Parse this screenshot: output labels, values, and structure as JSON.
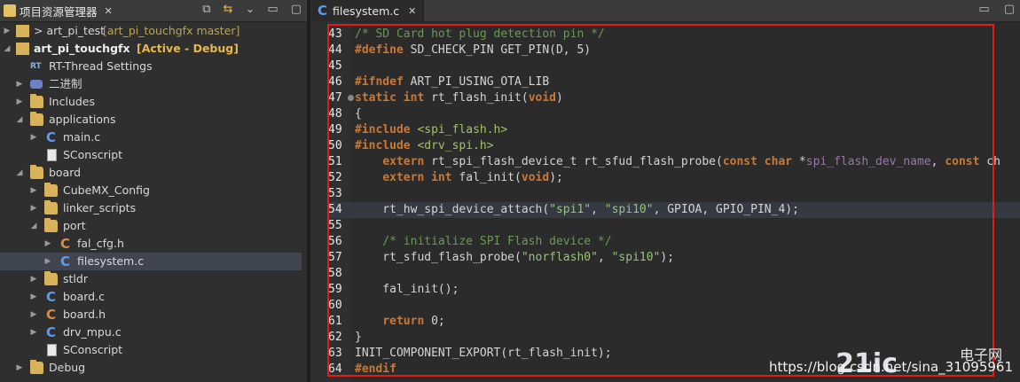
{
  "explorer": {
    "title": "项目资源管理器",
    "items": [
      {
        "label": "> art_pi_test",
        "suffix": "[art_pi_touchgfx master]"
      },
      {
        "label": "art_pi_touchgfx",
        "suffix": "[Active - Debug]"
      },
      {
        "label": "RT-Thread Settings"
      },
      {
        "label": "二进制"
      },
      {
        "label": "Includes"
      },
      {
        "label": "applications"
      },
      {
        "label": "main.c"
      },
      {
        "label": "SConscript"
      },
      {
        "label": "board"
      },
      {
        "label": "CubeMX_Config"
      },
      {
        "label": "linker_scripts"
      },
      {
        "label": "port"
      },
      {
        "label": "fal_cfg.h"
      },
      {
        "label": "filesystem.c"
      },
      {
        "label": "stldr"
      },
      {
        "label": "board.c"
      },
      {
        "label": "board.h"
      },
      {
        "label": "drv_mpu.c"
      },
      {
        "label": "SConscript"
      },
      {
        "label": "Debug"
      }
    ]
  },
  "editor": {
    "tab_title": "filesystem.c",
    "lines": [
      {
        "num": "43",
        "text": "/* SD Card hot plug detection pin */"
      },
      {
        "num": "44",
        "text": "#define SD_CHECK_PIN GET_PIN(D, 5)"
      },
      {
        "num": "45",
        "text": ""
      },
      {
        "num": "46",
        "text": "#ifndef ART_PI_USING_OTA_LIB"
      },
      {
        "num": "47",
        "text": "static int rt_flash_init(void)"
      },
      {
        "num": "48",
        "text": "{"
      },
      {
        "num": "49",
        "text": "#include <spi_flash.h>"
      },
      {
        "num": "50",
        "text": "#include <drv_spi.h>"
      },
      {
        "num": "51",
        "text": "    extern rt_spi_flash_device_t rt_sfud_flash_probe(const char *spi_flash_dev_name, const ch"
      },
      {
        "num": "52",
        "text": "    extern int fal_init(void);"
      },
      {
        "num": "53",
        "text": ""
      },
      {
        "num": "54",
        "text": "    rt_hw_spi_device_attach(\"spi1\", \"spi10\", GPIOA, GPIO_PIN_4);"
      },
      {
        "num": "55",
        "text": ""
      },
      {
        "num": "56",
        "text": "    /* initialize SPI Flash device */"
      },
      {
        "num": "57",
        "text": "    rt_sfud_flash_probe(\"norflash0\", \"spi10\");"
      },
      {
        "num": "58",
        "text": ""
      },
      {
        "num": "59",
        "text": "    fal_init();"
      },
      {
        "num": "60",
        "text": ""
      },
      {
        "num": "61",
        "text": "    return 0;"
      },
      {
        "num": "62",
        "text": "}"
      },
      {
        "num": "63",
        "text": "INIT_COMPONENT_EXPORT(rt_flash_init);"
      },
      {
        "num": "64",
        "text": "#endif"
      }
    ]
  },
  "watermark": {
    "url": "https://blog.csdn.net/sina_31095961",
    "logo": "21ic",
    "logo_sub": "电子网"
  },
  "colors": {
    "highlight_box": "#e81919",
    "keyword": "#cc7832",
    "comment": "#6a9955",
    "string": "#98c379"
  }
}
